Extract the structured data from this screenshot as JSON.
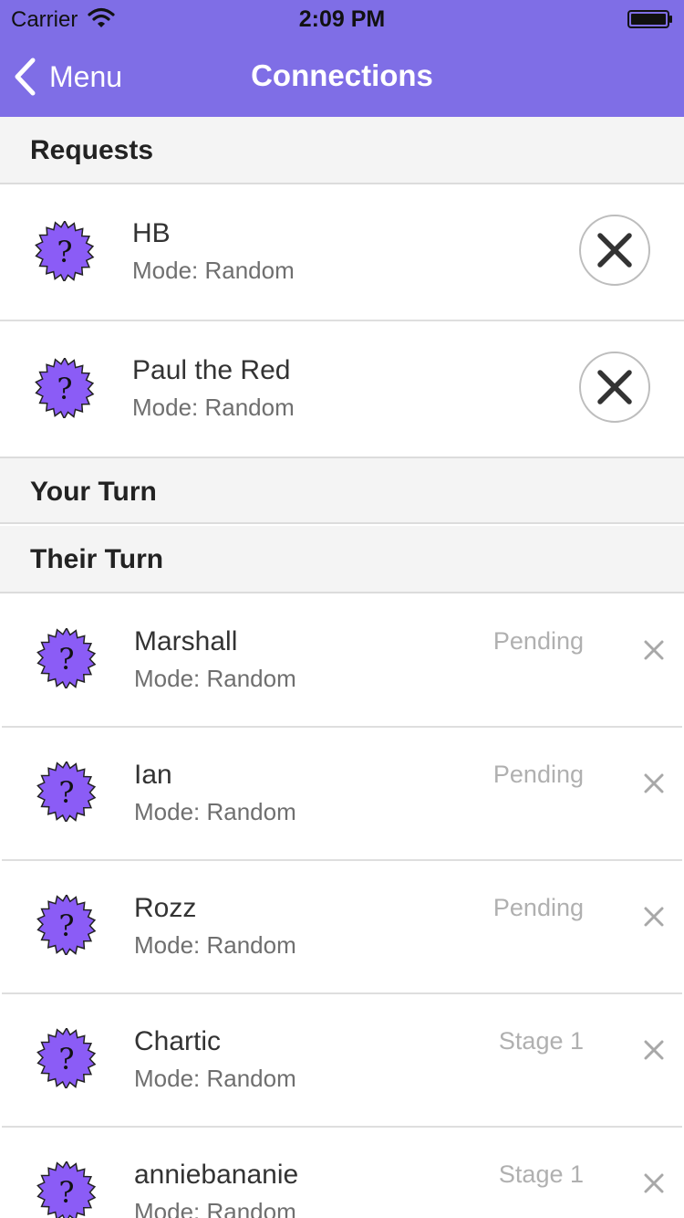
{
  "status_bar": {
    "carrier": "Carrier",
    "time": "2:09 PM"
  },
  "nav": {
    "back_label": "Menu",
    "title": "Connections"
  },
  "sections": {
    "requests": "Requests",
    "your_turn": "Your Turn",
    "their_turn": "Their Turn"
  },
  "requests": [
    {
      "name": "HB",
      "mode": "Mode: Random"
    },
    {
      "name": "Paul the Red",
      "mode": "Mode: Random"
    }
  ],
  "their_turn": [
    {
      "name": "Marshall",
      "mode": "Mode: Random",
      "status": "Pending"
    },
    {
      "name": "Ian",
      "mode": "Mode: Random",
      "status": "Pending"
    },
    {
      "name": "Rozz",
      "mode": "Mode: Random",
      "status": "Pending"
    },
    {
      "name": "Chartic",
      "mode": "Mode: Random",
      "status": "Stage 1"
    },
    {
      "name": "anniebananie",
      "mode": "Mode: Random",
      "status": "Stage 1"
    }
  ],
  "colors": {
    "accent": "#7f6ee6",
    "avatar": "#8b5cf6",
    "section_bg": "#f4f4f4"
  },
  "icons": {
    "avatar": "question-badge-icon",
    "decline": "close-circle-icon",
    "remove": "close-icon"
  }
}
